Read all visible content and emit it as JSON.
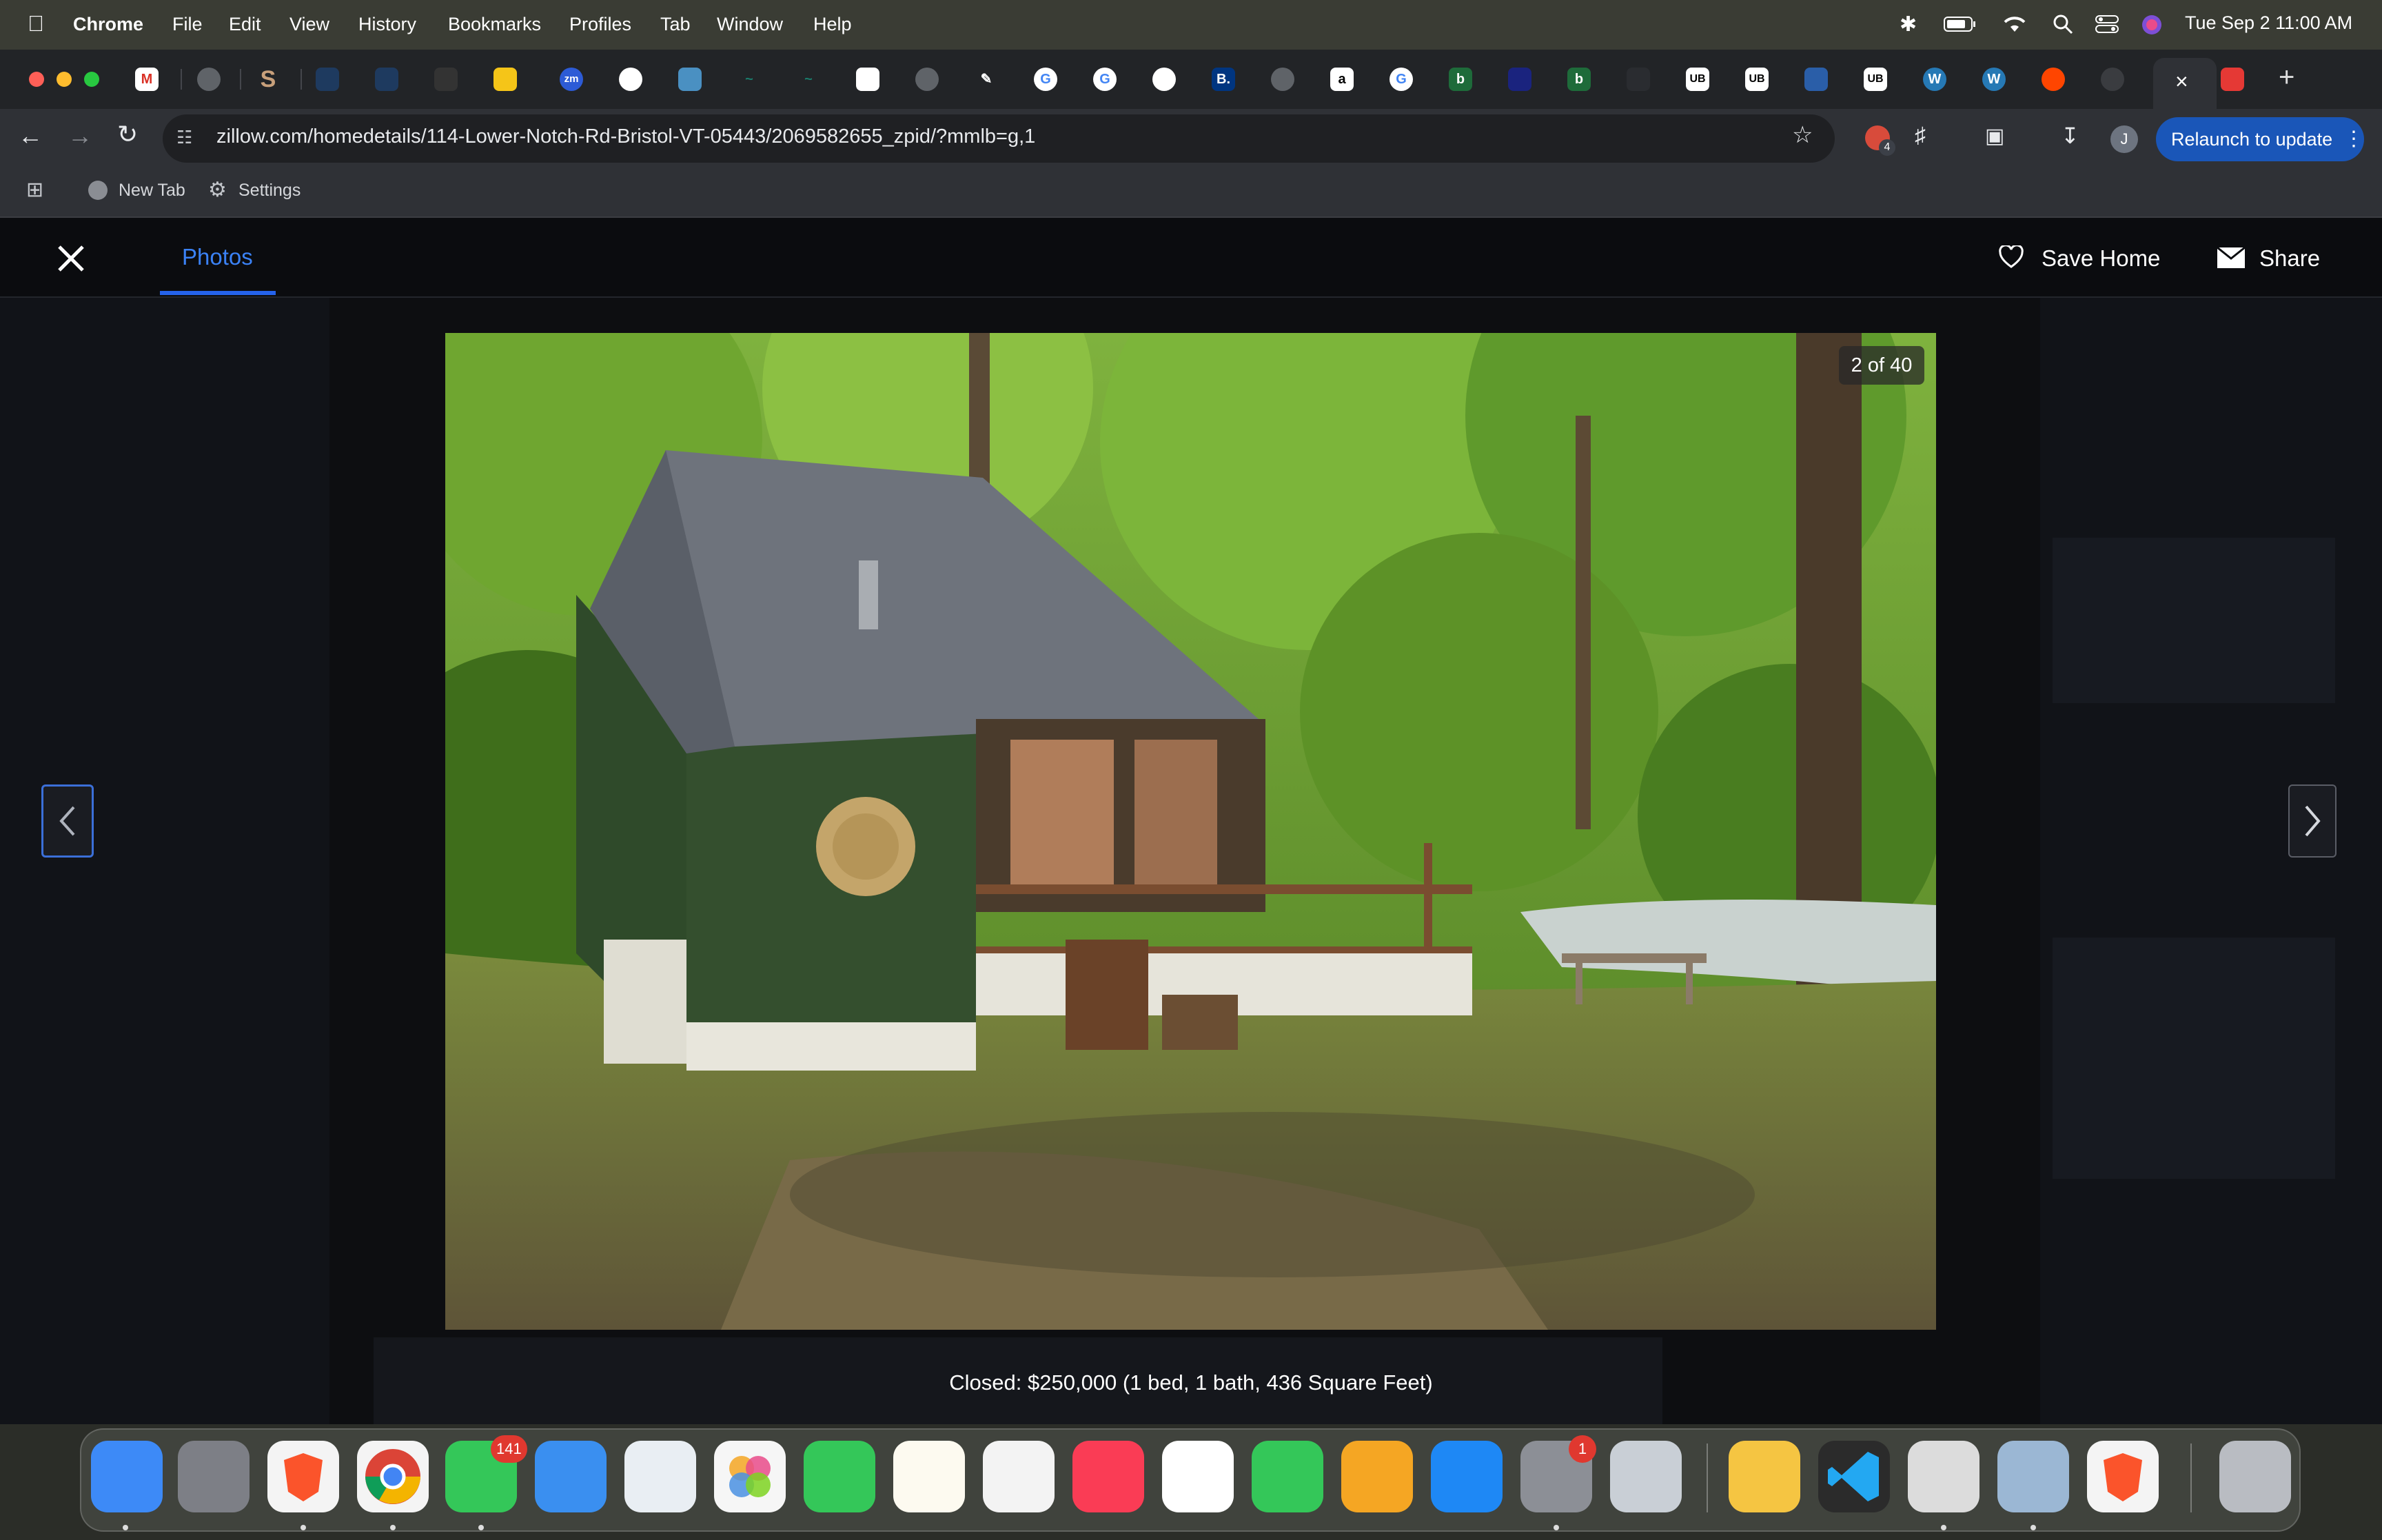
{
  "menubar": {
    "app": "Chrome",
    "items": [
      "File",
      "Edit",
      "View",
      "History",
      "Bookmarks",
      "Profiles",
      "Tab",
      "Window",
      "Help"
    ],
    "datetime": "Tue Sep 2  11:00 AM"
  },
  "browser": {
    "url": "zillow.com/homedetails/114-Lower-Notch-Rd-Bristol-VT-05443/2069582655_zpid/?mmlb=g,1",
    "relaunch_label": "Relaunch to update",
    "profile_initial": "J",
    "extension_badge": "4",
    "tab_favicons": [
      "M",
      "S",
      "zm",
      "B.",
      "a",
      "b",
      "b",
      "UB",
      "UB",
      "UB"
    ],
    "bookmarks": {
      "new_tab": "New Tab",
      "settings": "Settings"
    }
  },
  "lightbox": {
    "tab_label": "Photos",
    "save_label": "Save Home",
    "share_label": "Share",
    "counter": "2 of 40",
    "caption": "Closed: $250,000 (1 bed, 1 bath, 436 Square Feet)"
  },
  "dock": {
    "messages_badge": "141",
    "settings_badge": "1"
  },
  "colors": {
    "accent": "#2563eb",
    "relaunch": "#1a56b8",
    "page_bg": "#0d0e11"
  }
}
